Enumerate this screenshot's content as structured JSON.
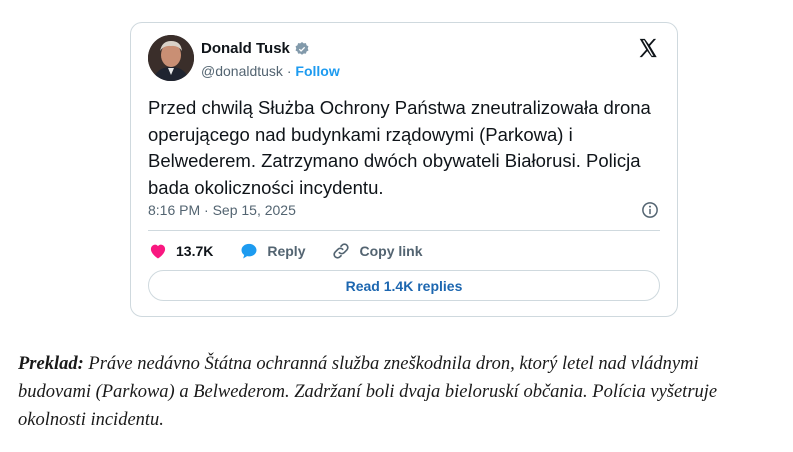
{
  "tweet": {
    "name": "Donald Tusk",
    "handle": "@donaldtusk",
    "separator": "·",
    "follow": "Follow",
    "text": "Przed chwilą Służba Ochrony Państwa zneutralizowała drona operującego nad budynkami rządowymi (Parkowa) i Belwederem. Zatrzymano dwóch obywateli Białorusi. Policja bada okoliczności incydentu.",
    "timestamp": "8:16 PM · Sep 15, 2025",
    "likes": "13.7K",
    "reply": "Reply",
    "copy_link": "Copy link",
    "read_replies": "Read 1.4K replies",
    "icons": {
      "verified": "verified-badge-icon",
      "x": "x-logo-icon",
      "info": "info-icon",
      "like": "heart-icon",
      "reply": "speech-bubble-icon",
      "link": "link-icon"
    },
    "colors": {
      "like": "#f91880",
      "reply": "#1d9bf0",
      "follow": "#1d9bf0",
      "read": "#1d67b0"
    }
  },
  "caption": {
    "label": "Preklad:",
    "text": " Práve nedávno Štátna ochranná služba zneškodnila dron, ktorý letel nad vládnymi budovami (Parkowa) a Belwederom. Zadržaní boli dvaja bieloruskí občania. Polícia vyšetruje okolnosti incidentu."
  }
}
